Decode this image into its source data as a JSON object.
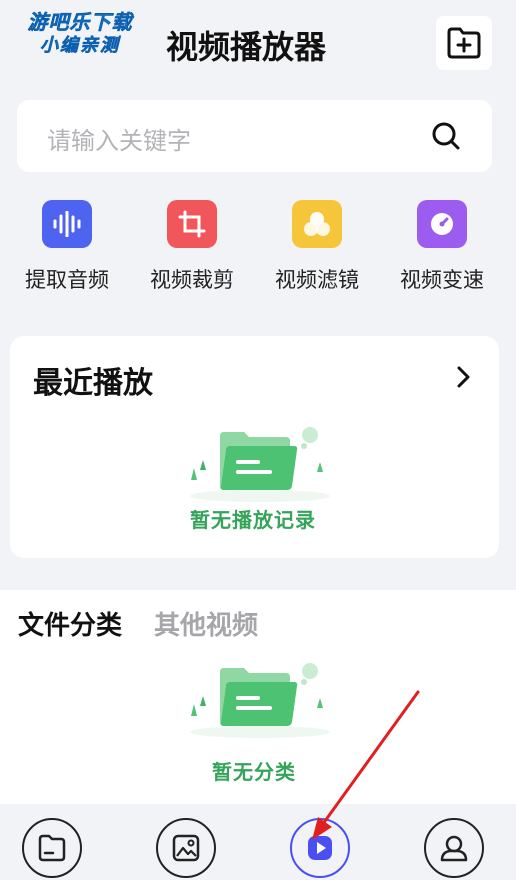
{
  "watermark": {
    "line1": "游吧乐下载",
    "line2": "小编亲测"
  },
  "header": {
    "title": "视频播放器",
    "new_folder_icon": "folder-plus-icon"
  },
  "search": {
    "placeholder": "请输入关键字",
    "icon": "search-icon"
  },
  "tools": [
    {
      "label": "提取音频",
      "icon": "audio-wave-icon",
      "color": "#4e63f0"
    },
    {
      "label": "视频裁剪",
      "icon": "crop-icon",
      "color": "#f0565a"
    },
    {
      "label": "视频滤镜",
      "icon": "filter-icon",
      "color": "#f5c53a"
    },
    {
      "label": "视频变速",
      "icon": "speed-icon",
      "color": "#9c5cf0"
    }
  ],
  "recent": {
    "title": "最近播放",
    "empty_text": "暂无播放记录"
  },
  "file_tabs": {
    "active": "文件分类",
    "inactive": "其他视频"
  },
  "files": {
    "empty_text": "暂无分类"
  },
  "bottom_nav": [
    {
      "icon": "folder-icon"
    },
    {
      "icon": "image-icon"
    },
    {
      "icon": "play-icon",
      "active": true
    },
    {
      "icon": "profile-icon"
    }
  ],
  "colors": {
    "accent": "#4b4ff2",
    "empty_green": "#35a45b",
    "background": "#f2f3f7",
    "annotation_arrow": "#e02020"
  }
}
